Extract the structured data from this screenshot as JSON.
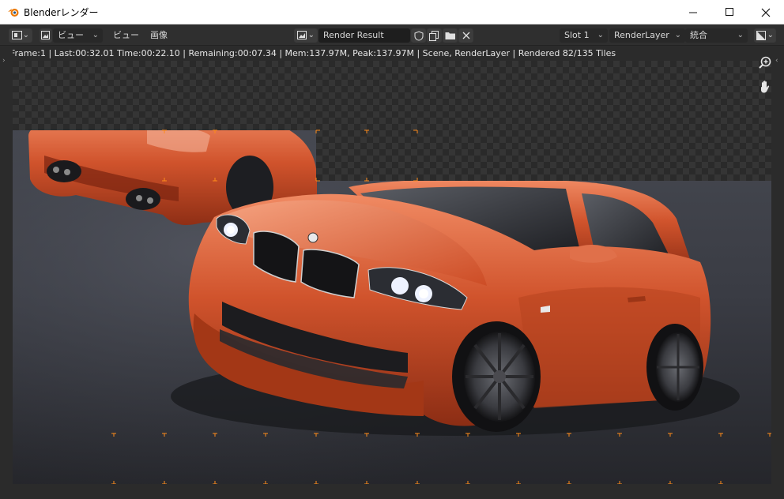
{
  "window": {
    "title": "Blenderレンダー",
    "minimize_label": "—",
    "maximize_label": "☐",
    "close_label": "✕"
  },
  "header": {
    "view_menu_dropdown": "ビュー",
    "menu_view": "ビュー",
    "menu_image": "画像",
    "image_name": "Render Result",
    "slot": "Slot 1",
    "layer": "RenderLayer",
    "pass": "統合"
  },
  "status": {
    "text": "Frame:1 | Last:00:32.01 Time:00:22.10 | Remaining:00:07.34 | Mem:137.97M, Peak:137.97M | Scene, RenderLayer | Rendered 82/135 Tiles"
  },
  "render": {
    "tiles_total": 135,
    "tiles_rendered": 82,
    "car_color": "#d0532c",
    "floor_color": "#3b3d45",
    "tile_marker_color": "#ff8c1a"
  },
  "icons": {
    "zoom": "zoom-in-icon",
    "pan": "hand-pan-icon"
  }
}
